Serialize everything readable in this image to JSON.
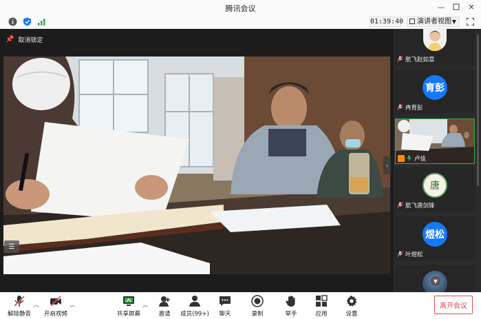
{
  "window": {
    "title": "腾讯会议"
  },
  "status": {
    "timer": "01:39:40",
    "view_mode": "演讲者视图"
  },
  "stage": {
    "unlock_label": "取消锁定"
  },
  "participants": [
    {
      "name": "航飞赵如意",
      "avatar_type": "photo",
      "mic_state": "muted"
    },
    {
      "name": "冉育彭",
      "avatar_type": "initials",
      "avatar_text": "育彭",
      "avatar_color": "#1677ff",
      "mic_state": "muted"
    },
    {
      "name": "卢佳",
      "avatar_type": "video",
      "mic_state": "speaking",
      "active": true
    },
    {
      "name": "航飞唐剑锋",
      "avatar_type": "logo",
      "avatar_text": "唐",
      "mic_state": "muted"
    },
    {
      "name": "叶煜松",
      "avatar_type": "initials",
      "avatar_text": "煜松",
      "avatar_color": "#1677ff",
      "mic_state": "muted"
    }
  ],
  "toolbar": {
    "unmute": "解除静音",
    "start_video": "开启视频",
    "share_screen": "共享屏幕",
    "invite": "邀请",
    "members": "成员(99+)",
    "chat": "聊天",
    "record": "录制",
    "raise_hand": "举手",
    "apps": "应用",
    "settings": "设置",
    "leave": "离开会议"
  },
  "colors": {
    "accent_blue": "#1677ff",
    "active_green": "#2fb14a",
    "leave_red": "#e34b4b",
    "stage_bg": "#1c1c1c"
  }
}
